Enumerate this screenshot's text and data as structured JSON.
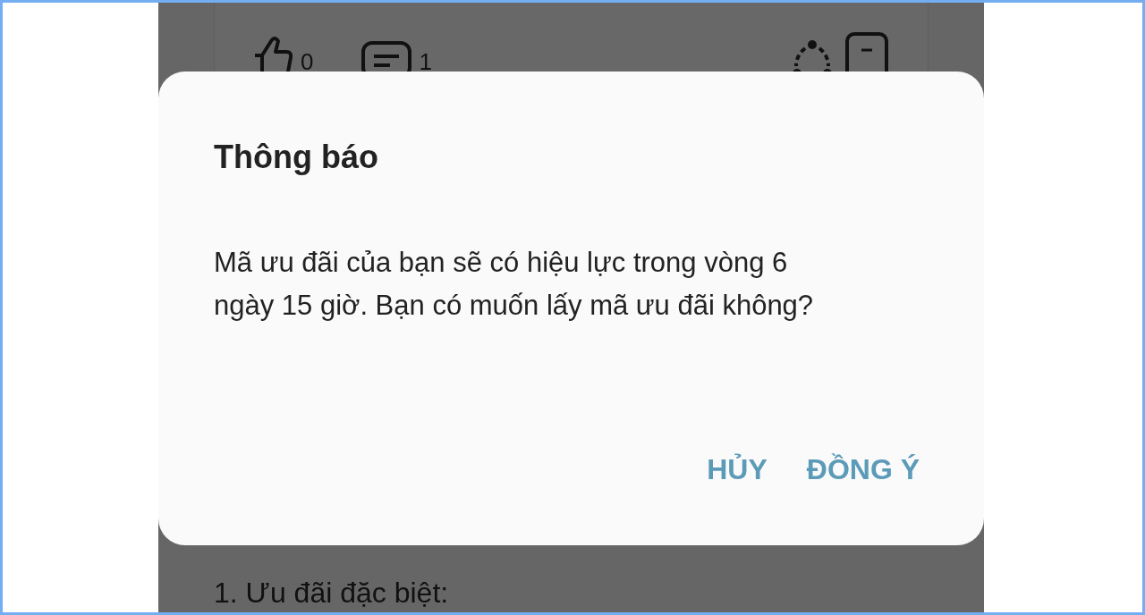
{
  "post_actions": {
    "likes": "0",
    "comments": "1"
  },
  "dialog": {
    "title": "Thông báo",
    "message": "Mã ưu đãi của bạn sẽ có hiệu lực trong vòng 6 ngày 15 giờ. Bạn có muốn lấy mã ưu đãi không?",
    "buttons": [
      "HỦY",
      "ĐỒNG Ý"
    ]
  },
  "content": {
    "heading": "1. Ưu đãi đặc biệt:"
  }
}
